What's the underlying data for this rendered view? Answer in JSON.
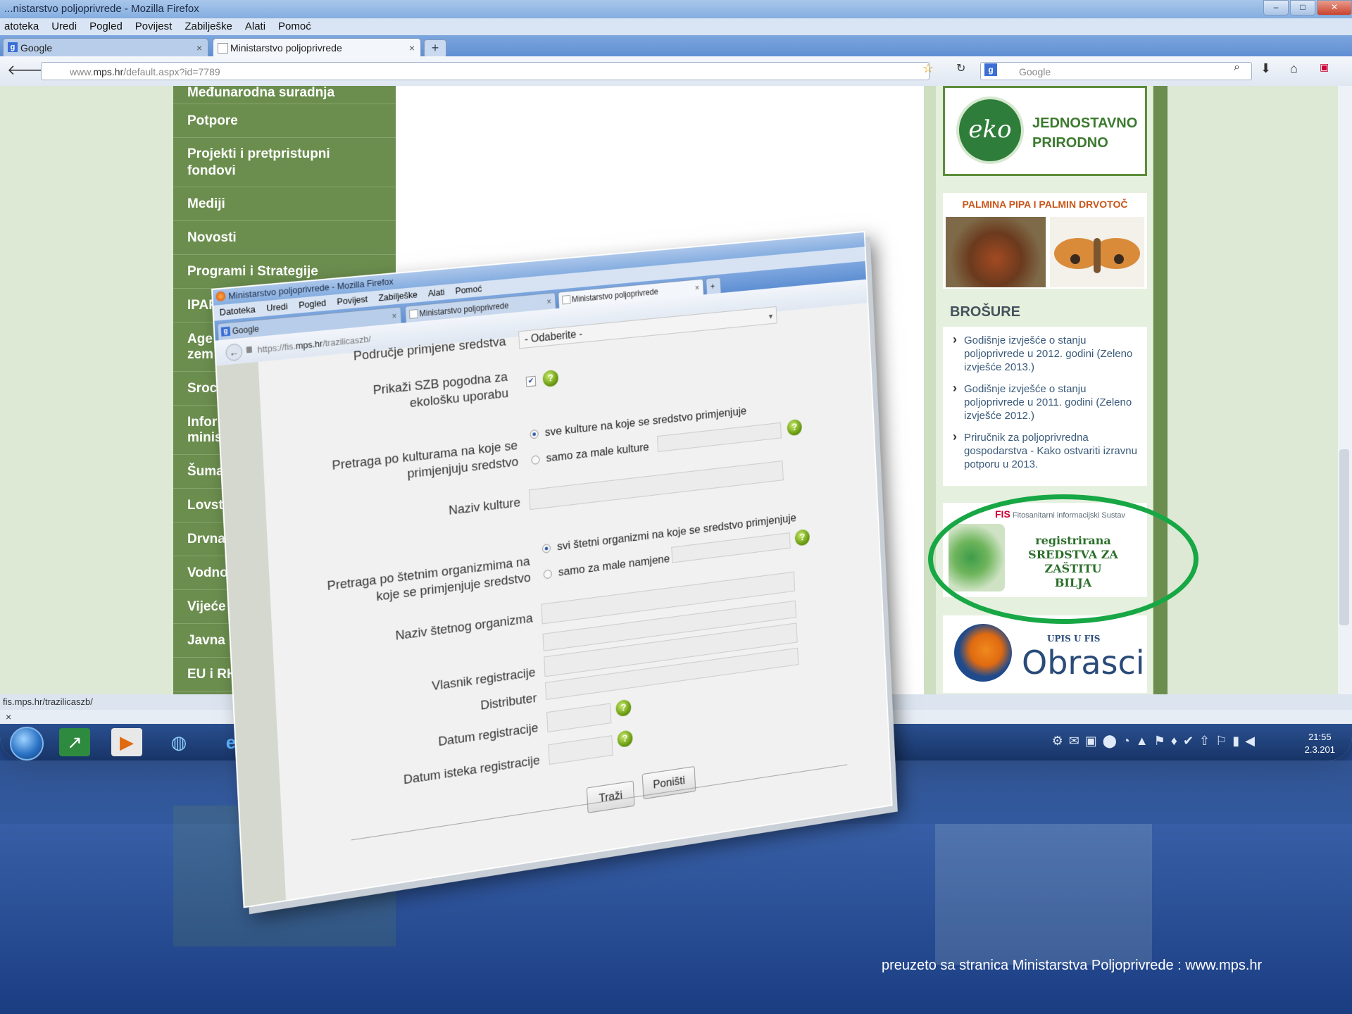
{
  "bg_browser": {
    "title": "...nistarstvo poljoprivrede - Mozilla Firefox",
    "menu": [
      "atoteka",
      "Uredi",
      "Pogled",
      "Povijest",
      "Zabilješke",
      "Alati",
      "Pomoć"
    ],
    "tabs": [
      {
        "label": "Google",
        "icon": "google-icon"
      },
      {
        "label": "Ministarstvo poljoprivrede",
        "icon": "page-icon",
        "active": true
      }
    ],
    "url_prefix": "www.",
    "url_domain": "mps.hr",
    "url_path": "/default.aspx?id=7789",
    "search_placeholder": "Google",
    "status_url": "fis.mps.hr/trazilicaszb/",
    "findbar_close": "×"
  },
  "sidebar": {
    "items": [
      {
        "label": "Međunarodna suradnja"
      },
      {
        "label": "Potpore"
      },
      {
        "label": "Projekti i pretpristupni fondovi"
      },
      {
        "label": "Mediji"
      },
      {
        "label": "Novosti"
      },
      {
        "label": "Programi i Strategije"
      },
      {
        "label": "IPARD"
      },
      {
        "label": "Age zem"
      },
      {
        "label": "Sroc"
      },
      {
        "label": "Infor minis"
      },
      {
        "label": "Šuma"
      },
      {
        "label": "Lovst"
      },
      {
        "label": "Drvna"
      },
      {
        "label": "Vodno"
      },
      {
        "label": "Vijeće z"
      },
      {
        "label": "Javna n"
      },
      {
        "label": "EU i RH"
      }
    ]
  },
  "right_column": {
    "eko": {
      "logo_text": "eko",
      "line1": "JEDNOSTAVNO",
      "line2": "PRIRODNO"
    },
    "palm_title": "PALMINA PIPA I PALMIN DRVOTOČ",
    "brosure_heading": "BROŠURE",
    "brosure_items": [
      "Godišnje izvješće o stanju poljoprivrede u 2012. godini (Zeleno izvješće 2013.)",
      "Godišnje izvješće o stanju poljoprivrede u 2011. godini (Zeleno izvješće 2012.)",
      "Priručnik za poljoprivredna gospodarstva - Kako ostvariti izravnu potporu u 2013."
    ],
    "fis": {
      "logo": "FIS",
      "subtitle": "Fitosanitarni informacijski Sustav",
      "line1": "registrirana",
      "line2": "SREDSTVA ZA ZAŠTITU",
      "line3": "BILJA"
    },
    "obrasci": {
      "upis": "UPIS U FIS",
      "label": "Obrasci"
    }
  },
  "taskbar": {
    "time": "21:55",
    "date": "2.3.201"
  },
  "fg_browser": {
    "title": "Ministarstvo poljoprivrede - Mozilla Firefox",
    "menu": [
      "Datoteka",
      "Uredi",
      "Pogled",
      "Povijest",
      "Zabilješke",
      "Alati",
      "Pomoć"
    ],
    "tabs": [
      {
        "label": "Google"
      },
      {
        "label": "Ministarstvo poljoprivrede"
      },
      {
        "label": "Ministarstvo poljoprivrede"
      }
    ],
    "new_tab": "+",
    "url_prefix": "https://fis.",
    "url_domain": "mps.hr",
    "url_path": "/trazilicaszb/"
  },
  "form": {
    "podrucje_label": "Područje primjene sredstva",
    "podrucje_value": "- Odaberite -",
    "eko_label": "Prikaži SZB pogodna za ekološku uporabu",
    "eko_checked": true,
    "kulture_label": "Pretraga po kulturama na koje se primjenjuju sredstvo",
    "kulture_opt1": "sve kulture na koje se sredstvo primjenjuje",
    "kulture_opt2": "samo za male kulture",
    "naziv_kulture_label": "Naziv kulture",
    "organizmi_label": "Pretraga po štetnim organizmima na koje se primjenjuje sredstvo",
    "organizmi_opt1": "svi štetni organizmi na koje se sredstvo primjenjuje",
    "organizmi_opt2": "samo za male namjene",
    "naziv_organizma_label": "Naziv štetnog organizma",
    "vlasnik_label": "Vlasnik registracije",
    "distributer_label": "Distributer",
    "datum_reg_label": "Datum registracije",
    "datum_isteka_label": "Datum isteka registracije",
    "search_button": "Traži",
    "reset_button": "Poništi",
    "help_glyph": "?"
  },
  "credit": "preuzeto sa stranica Ministarstva Poljoprivrede : www.mps.hr",
  "colors": {
    "sidebar_green": "#6b8e4e",
    "highlight_ellipse": "#17a745",
    "taskbar_blue": "#173467"
  }
}
